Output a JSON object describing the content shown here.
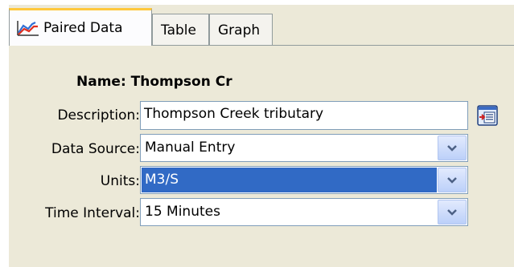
{
  "tabs": [
    {
      "label": "Paired Data",
      "icon": "paired-data-curve-icon",
      "active": true
    },
    {
      "label": "Table",
      "active": false
    },
    {
      "label": "Graph",
      "active": false
    }
  ],
  "form": {
    "name_label": "Name:",
    "name_value": "Thompson Cr",
    "description_label": "Description:",
    "description_value": "Thompson Creek tributary",
    "description_button_icon": "edit-description-icon",
    "data_source_label": "Data Source:",
    "data_source_value": "Manual Entry",
    "units_label": "Units:",
    "units_value": "M3/S",
    "time_interval_label": "Time Interval:",
    "time_interval_value": "15 Minutes"
  },
  "colors": {
    "panel_background": "#ece9d8",
    "active_tab_accent": "#ffc83c",
    "selection_highlight": "#316ac5",
    "field_border": "#7f9db9"
  }
}
